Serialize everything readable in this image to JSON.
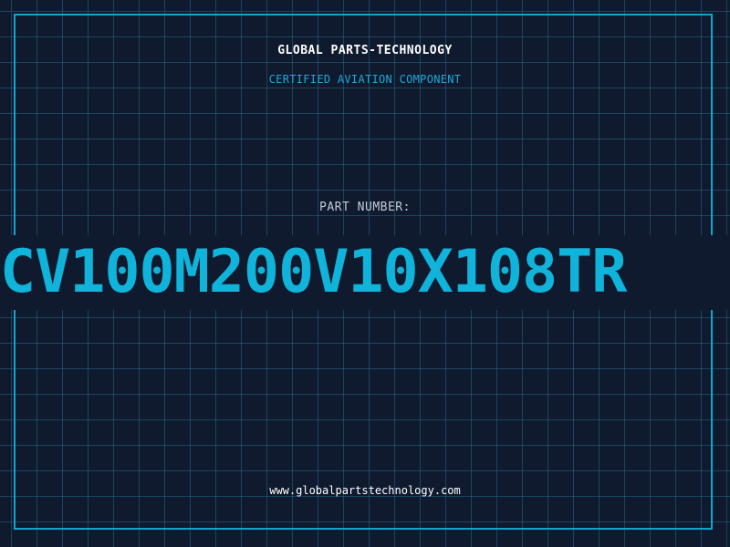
{
  "header": {
    "brand": "GLOBAL PARTS-TECHNOLOGY",
    "tagline": "CERTIFIED AVIATION COMPONENT"
  },
  "part": {
    "label": "PART NUMBER:",
    "number": "CV100M200V10X108TR"
  },
  "footer": {
    "url": "www.globalpartstechnology.com"
  },
  "colors": {
    "background": "#101a2f",
    "accent": "#10b4da",
    "grid": "#287896"
  }
}
